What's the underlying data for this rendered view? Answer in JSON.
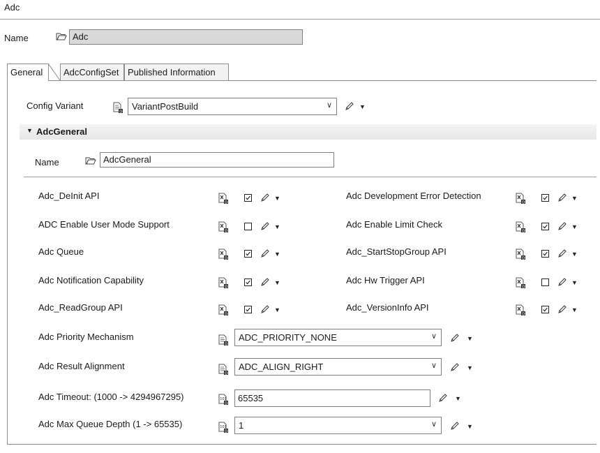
{
  "window": {
    "title": "Adc"
  },
  "top": {
    "name_label": "Name",
    "name_value": "Adc"
  },
  "tabs": [
    {
      "label": "General",
      "active": true
    },
    {
      "label": "AdcConfigSet",
      "active": false
    },
    {
      "label": "Published Information",
      "active": false
    }
  ],
  "config_variant": {
    "label": "Config Variant",
    "value": "VariantPostBuild"
  },
  "section": {
    "title": "AdcGeneral",
    "name_label": "Name",
    "name_value": "AdcGeneral"
  },
  "params_left": [
    {
      "label": "Adc_DeInit API",
      "checked": true
    },
    {
      "label": "ADC Enable User Mode Support",
      "checked": false
    },
    {
      "label": "Adc Queue",
      "checked": true
    },
    {
      "label": "Adc Notification Capability",
      "checked": true
    },
    {
      "label": "Adc_ReadGroup API",
      "checked": true
    }
  ],
  "params_right": [
    {
      "label": "Adc Development Error Detection",
      "checked": true
    },
    {
      "label": "Adc Enable Limit Check",
      "checked": true
    },
    {
      "label": "Adc_StartStopGroup API",
      "checked": true
    },
    {
      "label": "Adc Hw Trigger  API",
      "checked": false
    },
    {
      "label": "Adc_VersionInfo API",
      "checked": true
    }
  ],
  "fields": [
    {
      "label": "Adc Priority Mechanism",
      "value": "ADC_PRIORITY_NONE",
      "kind": "combo"
    },
    {
      "label": "Adc Result Alignment",
      "value": "ADC_ALIGN_RIGHT",
      "kind": "combo"
    },
    {
      "label": "Adc Timeout: (1000 -> 4294967295)",
      "value": "65535",
      "kind": "text"
    },
    {
      "label": "Adc Max Queue Depth (1 -> 65535)",
      "value": "1",
      "kind": "combo"
    }
  ],
  "icons": {
    "folder": "folder-icon",
    "variant_doc": "document-icon",
    "bool_doc": "boolean-document-icon",
    "number_doc": "number-document-icon",
    "pencil": "pencil-icon",
    "dropdown": "chevron-down-icon"
  },
  "colors": {
    "readonly_field": "#d9d9d9",
    "section_header": "#ececec"
  }
}
